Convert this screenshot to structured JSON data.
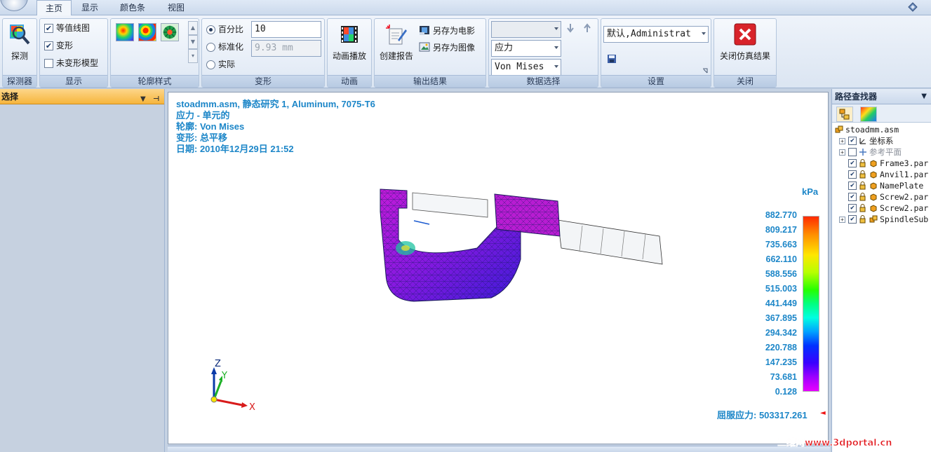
{
  "tabs": [
    {
      "label": "主页",
      "active": true
    },
    {
      "label": "显示",
      "active": false
    },
    {
      "label": "颜色条",
      "active": false
    },
    {
      "label": "视图",
      "active": false
    }
  ],
  "ribbon": {
    "probe": {
      "button_label": "探测",
      "group_label": "探测器"
    },
    "display": {
      "group_label": "显示",
      "items": [
        {
          "label": "等值线图",
          "checked": true
        },
        {
          "label": "变形",
          "checked": true
        },
        {
          "label": "未变形模型",
          "checked": false
        }
      ]
    },
    "contour_style": {
      "group_label": "轮廓样式"
    },
    "deform": {
      "group_label": "变形",
      "options": [
        {
          "label": "百分比",
          "selected": true,
          "value": "10"
        },
        {
          "label": "标准化",
          "selected": false,
          "value": "9.93 mm"
        },
        {
          "label": "实际",
          "selected": false
        }
      ]
    },
    "animation": {
      "button_label": "动画播放",
      "group_label": "动画"
    },
    "output": {
      "group_label": "输出结果",
      "create_report": "创建报告",
      "save_movie": "另存为电影",
      "save_image": "另存为图像"
    },
    "data_select": {
      "group_label": "数据选择",
      "combo1": "",
      "combo2": "应力",
      "combo3": "Von Mises"
    },
    "settings": {
      "group_label": "设置",
      "combo": "默认,Administrat"
    },
    "close": {
      "button_label": "关闭仿真结果",
      "group_label": "关闭"
    }
  },
  "left_panel": {
    "title": "选择"
  },
  "viewport": {
    "title_lines": [
      "stoadmm.asm, 静态研究 1, Aluminum, 7075-T6",
      "应力 - 单元的",
      "轮廓: Von Mises",
      "变形: 总平移",
      "日期: 2010年12月29日  21:52"
    ],
    "unit": "kPa",
    "legend_values": [
      "882.770",
      "809.217",
      "735.663",
      "662.110",
      "588.556",
      "515.003",
      "441.449",
      "367.895",
      "294.342",
      "220.788",
      "147.235",
      "73.681",
      "0.128"
    ],
    "yield": "屈服应力: 503317.261",
    "axes": {
      "x": "X",
      "y": "Y",
      "z": "Z"
    }
  },
  "right_panel": {
    "title": "路径查找器",
    "tree": [
      {
        "label": "stoadmm.asm",
        "level": 0,
        "expander": "",
        "checked": null
      },
      {
        "label": "坐标系",
        "level": 1,
        "expander": "+",
        "checked": true
      },
      {
        "label": "参考平面",
        "level": 1,
        "expander": "+",
        "checked": false
      },
      {
        "label": "Frame3.par",
        "level": 1,
        "expander": "",
        "checked": true
      },
      {
        "label": "Anvil1.par",
        "level": 1,
        "expander": "",
        "checked": true
      },
      {
        "label": "NamePlate",
        "level": 1,
        "expander": "",
        "checked": true
      },
      {
        "label": "Screw2.par",
        "level": 1,
        "expander": "",
        "checked": true
      },
      {
        "label": "Screw2.par",
        "level": 1,
        "expander": "",
        "checked": true
      },
      {
        "label": "SpindleSub",
        "level": 1,
        "expander": "+",
        "checked": true
      }
    ]
  },
  "watermark": "三维网www.3dportal.cn"
}
